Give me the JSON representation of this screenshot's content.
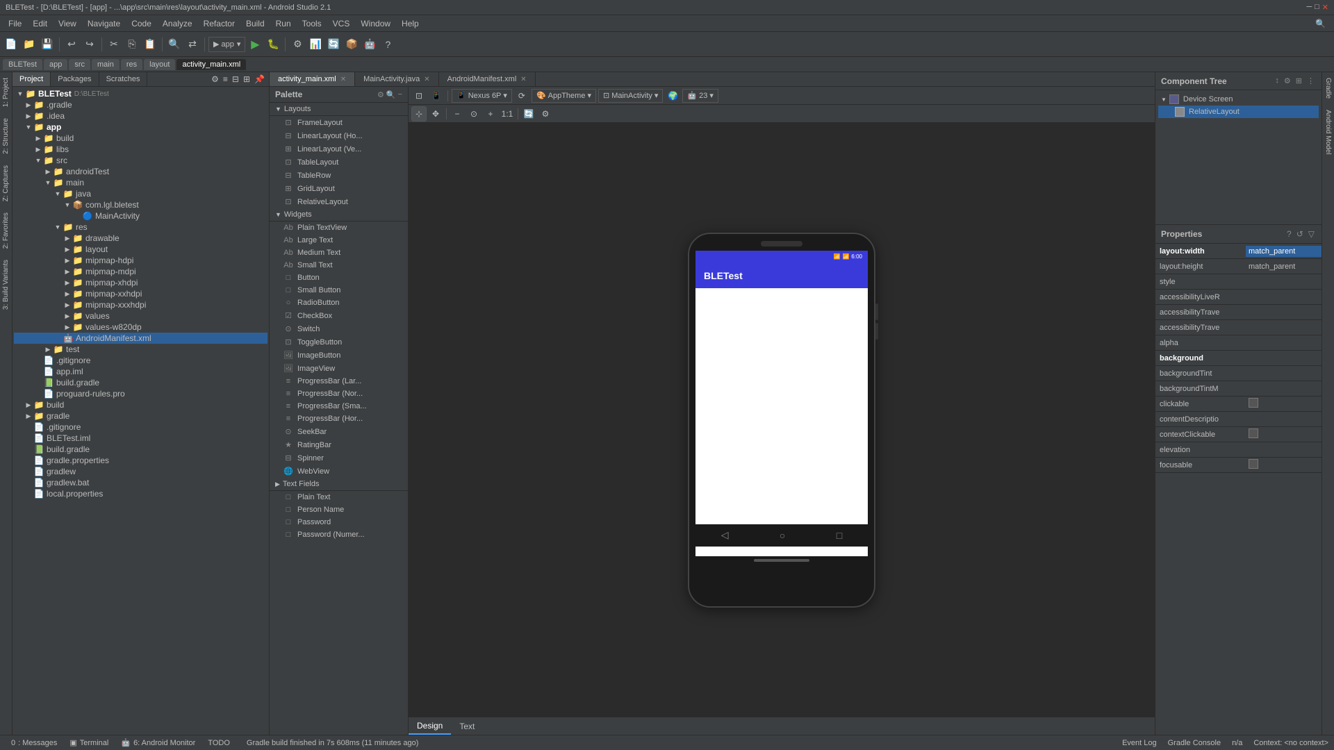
{
  "titleBar": {
    "text": "BLETest - [D:\\BLETest] - [app] - ...\\app\\src\\main\\res\\layout\\activity_main.xml - Android Studio 2.1"
  },
  "menuBar": {
    "items": [
      "File",
      "Edit",
      "View",
      "Navigate",
      "Code",
      "Analyze",
      "Refactor",
      "Build",
      "Run",
      "Tools",
      "VCS",
      "Window",
      "Help"
    ]
  },
  "fileTabs": {
    "items": [
      {
        "label": "BLETest",
        "active": false
      },
      {
        "label": "app",
        "active": false
      },
      {
        "label": "src",
        "active": false
      },
      {
        "label": "main",
        "active": false
      },
      {
        "label": "res",
        "active": false
      },
      {
        "label": "layout",
        "active": false
      },
      {
        "label": "activity_main.xml",
        "active": true
      }
    ]
  },
  "projectTabs": {
    "tabs": [
      "Project",
      "Packages",
      "Scratches"
    ],
    "active": "Project"
  },
  "projectTree": {
    "root": "BLETest",
    "rootPath": "D:\\BLETest",
    "items": [
      {
        "indent": 1,
        "label": ".gradle",
        "type": "folder",
        "expanded": false
      },
      {
        "indent": 1,
        "label": ".idea",
        "type": "folder",
        "expanded": false
      },
      {
        "indent": 1,
        "label": "app",
        "type": "folder",
        "expanded": true,
        "highlight": true
      },
      {
        "indent": 2,
        "label": "build",
        "type": "folder",
        "expanded": false
      },
      {
        "indent": 2,
        "label": "libs",
        "type": "folder",
        "expanded": false
      },
      {
        "indent": 2,
        "label": "src",
        "type": "folder",
        "expanded": true
      },
      {
        "indent": 3,
        "label": "androidTest",
        "type": "folder",
        "expanded": false
      },
      {
        "indent": 3,
        "label": "main",
        "type": "folder",
        "expanded": true
      },
      {
        "indent": 4,
        "label": "java",
        "type": "folder",
        "expanded": true
      },
      {
        "indent": 5,
        "label": "com.lgl.bletest",
        "type": "package",
        "expanded": true
      },
      {
        "indent": 6,
        "label": "MainActivity",
        "type": "class"
      },
      {
        "indent": 4,
        "label": "res",
        "type": "folder",
        "expanded": true
      },
      {
        "indent": 5,
        "label": "drawable",
        "type": "folder",
        "expanded": false
      },
      {
        "indent": 5,
        "label": "layout",
        "type": "folder",
        "expanded": false
      },
      {
        "indent": 5,
        "label": "mipmap-hdpi",
        "type": "folder",
        "expanded": false
      },
      {
        "indent": 5,
        "label": "mipmap-mdpi",
        "type": "folder",
        "expanded": false
      },
      {
        "indent": 5,
        "label": "mipmap-xhdpi",
        "type": "folder",
        "expanded": false
      },
      {
        "indent": 5,
        "label": "mipmap-xxhdpi",
        "type": "folder",
        "expanded": false
      },
      {
        "indent": 5,
        "label": "mipmap-xxxhdpi",
        "type": "folder",
        "expanded": false
      },
      {
        "indent": 5,
        "label": "values",
        "type": "folder",
        "expanded": false
      },
      {
        "indent": 5,
        "label": "values-w820dp",
        "type": "folder",
        "expanded": false
      },
      {
        "indent": 4,
        "label": "AndroidManifest.xml",
        "type": "xml",
        "selected": true
      },
      {
        "indent": 3,
        "label": "test",
        "type": "folder",
        "expanded": false
      },
      {
        "indent": 2,
        "label": ".gitignore",
        "type": "file"
      },
      {
        "indent": 2,
        "label": "app.iml",
        "type": "file"
      },
      {
        "indent": 2,
        "label": "build.gradle",
        "type": "gradle"
      },
      {
        "indent": 2,
        "label": "proguard-rules.pro",
        "type": "file"
      },
      {
        "indent": 1,
        "label": "build",
        "type": "folder",
        "expanded": false
      },
      {
        "indent": 1,
        "label": "gradle",
        "type": "folder",
        "expanded": false
      },
      {
        "indent": 1,
        "label": ".gitignore",
        "type": "file"
      },
      {
        "indent": 1,
        "label": "BLETest.iml",
        "type": "file"
      },
      {
        "indent": 1,
        "label": "build.gradle",
        "type": "gradle"
      },
      {
        "indent": 1,
        "label": "gradle.properties",
        "type": "file"
      },
      {
        "indent": 1,
        "label": "gradlew",
        "type": "file"
      },
      {
        "indent": 1,
        "label": "gradlew.bat",
        "type": "file"
      },
      {
        "indent": 1,
        "label": "local.properties",
        "type": "file"
      }
    ]
  },
  "editorTabs": [
    {
      "label": "activity_main.xml",
      "active": true
    },
    {
      "label": "MainActivity.java",
      "active": false
    },
    {
      "label": "AndroidManifest.xml",
      "active": false
    }
  ],
  "deviceToolbar": {
    "device": "Nexus 6P",
    "theme": "AppTheme",
    "activity": "MainActivity",
    "api": "23"
  },
  "palette": {
    "title": "Palette",
    "sections": [
      {
        "name": "Layouts",
        "items": [
          "FrameLayout",
          "LinearLayout (Ho...",
          "LinearLayout (Ve...",
          "TableLayout",
          "TableRow",
          "GridLayout",
          "RelativeLayout"
        ]
      },
      {
        "name": "Widgets",
        "items": [
          "Plain TextView",
          "Large Text",
          "Medium Text",
          "Small Text",
          "Button",
          "Small Button",
          "RadioButton",
          "CheckBox",
          "Switch",
          "ToggleButton",
          "ImageButton",
          "ImageView",
          "ProgressBar (Lar...",
          "ProgressBar (Nor...",
          "ProgressBar (Sma...",
          "ProgressBar (Hor...",
          "SeekBar",
          "RatingBar",
          "Spinner",
          "WebView"
        ]
      },
      {
        "name": "Text Fields",
        "items": [
          "Plain Text",
          "Person Name",
          "Password",
          "Password (Numer..."
        ]
      }
    ]
  },
  "phone": {
    "time": "6:00",
    "appTitle": "BLETest",
    "navButtons": [
      "◁",
      "○",
      "□"
    ]
  },
  "componentTree": {
    "title": "Component Tree",
    "items": [
      {
        "label": "Device Screen",
        "indent": 0,
        "expanded": true
      },
      {
        "label": "RelativeLayout",
        "indent": 1,
        "selected": true
      }
    ]
  },
  "properties": {
    "title": "Properties",
    "rows": [
      {
        "name": "layout:width",
        "value": "match_parent",
        "highlight": true,
        "bold": true
      },
      {
        "name": "layout:height",
        "value": "match_parent",
        "highlight": false,
        "bold": false
      },
      {
        "name": "style",
        "value": "",
        "highlight": false,
        "bold": false
      },
      {
        "name": "accessibilityLiveR",
        "value": "",
        "highlight": false,
        "bold": false
      },
      {
        "name": "accessibilityTrave",
        "value": "",
        "highlight": false,
        "bold": false
      },
      {
        "name": "accessibilityTrave",
        "value": "",
        "highlight": false,
        "bold": false
      },
      {
        "name": "alpha",
        "value": "",
        "highlight": false,
        "bold": false
      },
      {
        "name": "background",
        "value": "",
        "highlight": false,
        "bold": true
      },
      {
        "name": "backgroundTint",
        "value": "",
        "highlight": false,
        "bold": false
      },
      {
        "name": "backgroundTintM",
        "value": "",
        "highlight": false,
        "bold": false
      },
      {
        "name": "clickable",
        "value": "checkbox",
        "highlight": false,
        "bold": false
      },
      {
        "name": "contentDescriptio",
        "value": "",
        "highlight": false,
        "bold": false
      },
      {
        "name": "contextClickable",
        "value": "checkbox",
        "highlight": false,
        "bold": false
      },
      {
        "name": "elevation",
        "value": "",
        "highlight": false,
        "bold": false
      },
      {
        "name": "focusable",
        "value": "checkbox",
        "highlight": false,
        "bold": false
      }
    ]
  },
  "bottomTabs": {
    "design": "Design",
    "text": "Text",
    "activeTab": "Design"
  },
  "statusBar": {
    "tabs": [
      {
        "icon": "0",
        "label": "Messages"
      },
      {
        "icon": "⬛",
        "label": "Terminal"
      },
      {
        "icon": "6",
        "label": "Android Monitor"
      },
      {
        "icon": "",
        "label": "TODO"
      }
    ],
    "message": "Gradle build finished in 7s 608ms (11 minutes ago)",
    "right": {
      "eventLog": "Event Log",
      "gradleConsole": "Gradle Console",
      "position": "n/a",
      "context": "Context: <no context>"
    }
  },
  "leftEdgeTabs": [
    "1:Project",
    "2:Structure",
    "Z:Captures",
    "2:Favorites",
    "3:Build Variants"
  ],
  "rightEdgeTabs": [
    "Gradle",
    "Android Model"
  ]
}
